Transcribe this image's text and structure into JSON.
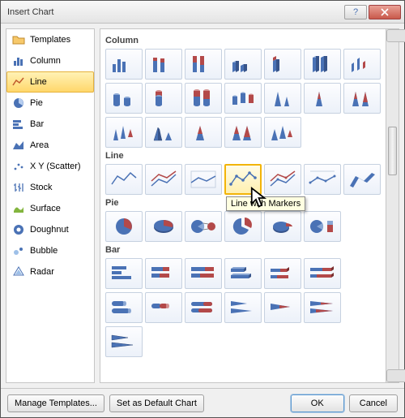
{
  "dialog": {
    "title": "Insert Chart"
  },
  "sidebar": {
    "items": [
      {
        "label": "Templates"
      },
      {
        "label": "Column"
      },
      {
        "label": "Line"
      },
      {
        "label": "Pie"
      },
      {
        "label": "Bar"
      },
      {
        "label": "Area"
      },
      {
        "label": "X Y (Scatter)"
      },
      {
        "label": "Stock"
      },
      {
        "label": "Surface"
      },
      {
        "label": "Doughnut"
      },
      {
        "label": "Bubble"
      },
      {
        "label": "Radar"
      }
    ],
    "selected_index": 2
  },
  "sections": {
    "column": "Column",
    "line": "Line",
    "pie": "Pie",
    "bar": "Bar"
  },
  "tooltip": {
    "text": "Line with Markers"
  },
  "footer": {
    "manage": "Manage Templates...",
    "setdefault": "Set as Default Chart",
    "ok": "OK",
    "cancel": "Cancel"
  },
  "colors": {
    "accent": "#ffd76b",
    "selection_border": "#f2b409",
    "icon_blue": "#4a72b5"
  }
}
